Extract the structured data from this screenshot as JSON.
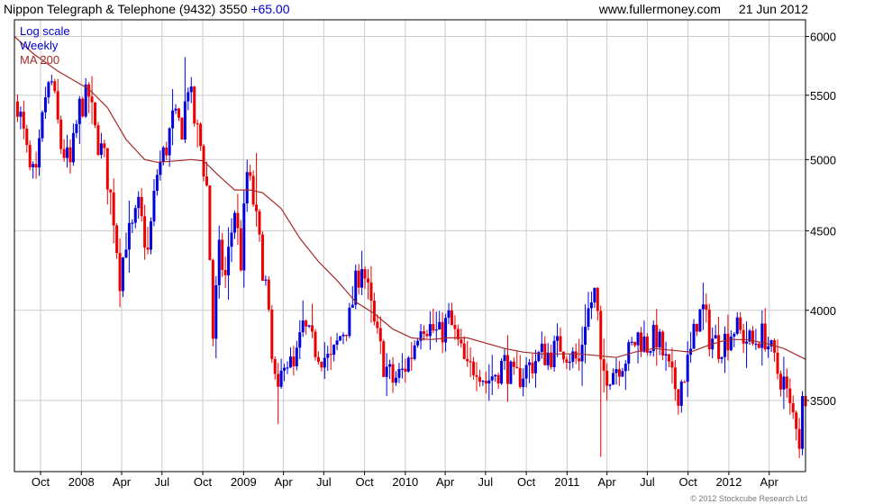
{
  "header": {
    "title": "Nippon Telegraph & Telephone (9432)",
    "price": "3550",
    "change": "+65.00",
    "site": "www.fullermoney.com",
    "date": "21 Jun 2012"
  },
  "footer": {
    "copyright": "© 2012 Stockcube Research Ltd"
  },
  "colors": {
    "up": "#0000dd",
    "down": "#ee0000",
    "ma": "#a52a2a",
    "grid": "#cccccc",
    "axis": "#000000"
  },
  "chart_data": {
    "type": "candlestick",
    "scale": "log",
    "period": "weekly",
    "grid": true,
    "legend": [
      {
        "label": "Log scale",
        "color": "#0000cc"
      },
      {
        "label": "Weekly",
        "color": "#0000cc"
      },
      {
        "label": "MA 200",
        "color": "#a52a2a"
      }
    ],
    "legend_position": "top-left",
    "ylim": [
      3150,
      6150
    ],
    "y_ticks": [
      3500,
      4000,
      4500,
      5000,
      5500,
      6000
    ],
    "x_range": [
      "2007-08-03",
      "2012-06-22"
    ],
    "x_ticks": [
      {
        "label": "Oct",
        "date": "2007-10-01"
      },
      {
        "label": "2008",
        "date": "2008-01-01"
      },
      {
        "label": "Apr",
        "date": "2008-04-01"
      },
      {
        "label": "Jul",
        "date": "2008-07-01"
      },
      {
        "label": "Oct",
        "date": "2008-10-01"
      },
      {
        "label": "2009",
        "date": "2009-01-01"
      },
      {
        "label": "Apr",
        "date": "2009-04-01"
      },
      {
        "label": "Jul",
        "date": "2009-07-01"
      },
      {
        "label": "Oct",
        "date": "2009-10-01"
      },
      {
        "label": "2010",
        "date": "2010-01-01"
      },
      {
        "label": "Apr",
        "date": "2010-04-01"
      },
      {
        "label": "Jul",
        "date": "2010-07-01"
      },
      {
        "label": "Oct",
        "date": "2010-10-01"
      },
      {
        "label": "2011",
        "date": "2011-01-01"
      },
      {
        "label": "Apr",
        "date": "2011-04-01"
      },
      {
        "label": "Jul",
        "date": "2011-07-01"
      },
      {
        "label": "Oct",
        "date": "2011-10-01"
      },
      {
        "label": "2012",
        "date": "2012-01-01"
      },
      {
        "label": "Apr",
        "date": "2012-04-01"
      }
    ],
    "close_path": [
      [
        "2007-08-10",
        5450
      ],
      [
        "2007-09-07",
        4900
      ],
      [
        "2007-09-21",
        4850
      ],
      [
        "2007-10-12",
        5500
      ],
      [
        "2007-10-26",
        5600
      ],
      [
        "2007-11-16",
        5100
      ],
      [
        "2007-12-07",
        4950
      ],
      [
        "2007-12-28",
        5400
      ],
      [
        "2008-01-18",
        5500
      ],
      [
        "2008-02-01",
        5200
      ],
      [
        "2008-02-22",
        5000
      ],
      [
        "2008-03-14",
        4600
      ],
      [
        "2008-03-28",
        4200
      ],
      [
        "2008-04-11",
        4450
      ],
      [
        "2008-04-25",
        4500
      ],
      [
        "2008-05-09",
        4650
      ],
      [
        "2008-05-30",
        4350
      ],
      [
        "2008-06-20",
        4900
      ],
      [
        "2008-07-11",
        5100
      ],
      [
        "2008-07-25",
        5300
      ],
      [
        "2008-08-15",
        5250
      ],
      [
        "2008-08-29",
        5600
      ],
      [
        "2008-09-12",
        5300
      ],
      [
        "2008-09-26",
        5100
      ],
      [
        "2008-10-10",
        4800
      ],
      [
        "2008-10-24",
        3850
      ],
      [
        "2008-11-07",
        4350
      ],
      [
        "2008-11-21",
        4200
      ],
      [
        "2008-12-12",
        4650
      ],
      [
        "2008-12-26",
        4300
      ],
      [
        "2009-01-09",
        4900
      ],
      [
        "2009-01-23",
        4700
      ],
      [
        "2009-02-06",
        4400
      ],
      [
        "2009-02-20",
        4150
      ],
      [
        "2009-03-06",
        3700
      ],
      [
        "2009-03-20",
        3500
      ],
      [
        "2009-04-03",
        3750
      ],
      [
        "2009-04-24",
        3650
      ],
      [
        "2009-05-15",
        3900
      ],
      [
        "2009-06-05",
        3800
      ],
      [
        "2009-06-26",
        3750
      ],
      [
        "2009-07-17",
        3700
      ],
      [
        "2009-08-07",
        3850
      ],
      [
        "2009-08-28",
        3950
      ],
      [
        "2009-09-11",
        4150
      ],
      [
        "2009-09-25",
        4300
      ],
      [
        "2009-10-09",
        4100
      ],
      [
        "2009-10-23",
        3900
      ],
      [
        "2009-11-13",
        3700
      ],
      [
        "2009-12-04",
        3600
      ],
      [
        "2009-12-25",
        3650
      ],
      [
        "2010-01-15",
        3750
      ],
      [
        "2010-02-05",
        3950
      ],
      [
        "2010-02-26",
        3900
      ],
      [
        "2010-03-19",
        3850
      ],
      [
        "2010-04-09",
        3950
      ],
      [
        "2010-04-30",
        3800
      ],
      [
        "2010-05-21",
        3650
      ],
      [
        "2010-06-11",
        3700
      ],
      [
        "2010-07-02",
        3600
      ],
      [
        "2010-07-23",
        3650
      ],
      [
        "2010-08-13",
        3700
      ],
      [
        "2010-09-03",
        3600
      ],
      [
        "2010-09-24",
        3650
      ],
      [
        "2010-10-15",
        3700
      ],
      [
        "2010-11-05",
        3750
      ],
      [
        "2010-11-26",
        3750
      ],
      [
        "2010-12-17",
        3800
      ],
      [
        "2011-01-07",
        3750
      ],
      [
        "2011-01-28",
        3700
      ],
      [
        "2011-02-11",
        3950
      ],
      [
        "2011-02-25",
        4050
      ],
      [
        "2011-03-04",
        4100
      ],
      [
        "2011-03-11",
        3950
      ],
      [
        "2011-03-18",
        3650
      ],
      [
        "2011-04-08",
        3650
      ],
      [
        "2011-04-29",
        3700
      ],
      [
        "2011-05-20",
        3750
      ],
      [
        "2011-06-10",
        3850
      ],
      [
        "2011-07-01",
        3800
      ],
      [
        "2011-07-22",
        3850
      ],
      [
        "2011-08-12",
        3700
      ],
      [
        "2011-08-26",
        3600
      ],
      [
        "2011-09-09",
        3550
      ],
      [
        "2011-09-23",
        3650
      ],
      [
        "2011-10-07",
        3750
      ],
      [
        "2011-10-21",
        3950
      ],
      [
        "2011-11-04",
        4000
      ],
      [
        "2011-11-18",
        3850
      ],
      [
        "2011-12-09",
        3800
      ],
      [
        "2011-12-30",
        3850
      ],
      [
        "2012-01-13",
        3900
      ],
      [
        "2012-02-03",
        3850
      ],
      [
        "2012-02-24",
        3800
      ],
      [
        "2012-03-09",
        3850
      ],
      [
        "2012-03-23",
        3850
      ],
      [
        "2012-04-06",
        3750
      ],
      [
        "2012-04-20",
        3650
      ],
      [
        "2012-05-04",
        3600
      ],
      [
        "2012-05-18",
        3450
      ],
      [
        "2012-06-01",
        3400
      ],
      [
        "2012-06-08",
        3300
      ],
      [
        "2012-06-15",
        3485
      ],
      [
        "2012-06-22",
        3550
      ]
    ],
    "ma200": [
      [
        "2007-08-03",
        6000
      ],
      [
        "2007-09-14",
        5850
      ],
      [
        "2007-11-09",
        5700
      ],
      [
        "2008-01-18",
        5550
      ],
      [
        "2008-02-29",
        5400
      ],
      [
        "2008-04-11",
        5150
      ],
      [
        "2008-05-23",
        5000
      ],
      [
        "2008-06-20",
        4980
      ],
      [
        "2008-08-01",
        4990
      ],
      [
        "2008-09-05",
        5000
      ],
      [
        "2008-10-03",
        4990
      ],
      [
        "2008-11-07",
        4880
      ],
      [
        "2008-12-12",
        4780
      ],
      [
        "2009-01-16",
        4780
      ],
      [
        "2009-02-13",
        4760
      ],
      [
        "2009-03-27",
        4650
      ],
      [
        "2009-05-08",
        4450
      ],
      [
        "2009-06-19",
        4300
      ],
      [
        "2009-07-31",
        4180
      ],
      [
        "2009-09-11",
        4050
      ],
      [
        "2009-10-23",
        3980
      ],
      [
        "2009-12-04",
        3890
      ],
      [
        "2010-01-15",
        3840
      ],
      [
        "2010-02-26",
        3830
      ],
      [
        "2010-04-09",
        3840
      ],
      [
        "2010-05-21",
        3840
      ],
      [
        "2010-07-02",
        3810
      ],
      [
        "2010-08-13",
        3780
      ],
      [
        "2010-09-24",
        3760
      ],
      [
        "2010-11-05",
        3750
      ],
      [
        "2010-12-17",
        3750
      ],
      [
        "2011-01-28",
        3750
      ],
      [
        "2011-03-11",
        3740
      ],
      [
        "2011-04-22",
        3730
      ],
      [
        "2011-06-03",
        3760
      ],
      [
        "2011-07-15",
        3780
      ],
      [
        "2011-08-26",
        3770
      ],
      [
        "2011-10-07",
        3760
      ],
      [
        "2011-11-18",
        3800
      ],
      [
        "2011-12-30",
        3830
      ],
      [
        "2012-02-10",
        3830
      ],
      [
        "2012-03-23",
        3810
      ],
      [
        "2012-05-04",
        3780
      ],
      [
        "2012-06-22",
        3720
      ]
    ],
    "spikes": [
      {
        "date": "2008-08-22",
        "high": 5820,
        "low": 5200
      },
      {
        "date": "2009-01-30",
        "high": 5050,
        "low": 4600
      },
      {
        "date": "2009-03-20",
        "high": 3700,
        "low": 3380
      },
      {
        "date": "2011-03-18",
        "high": 3900,
        "low": 3220
      },
      {
        "date": "2012-06-08",
        "high": 3400,
        "low": 3260
      }
    ]
  }
}
